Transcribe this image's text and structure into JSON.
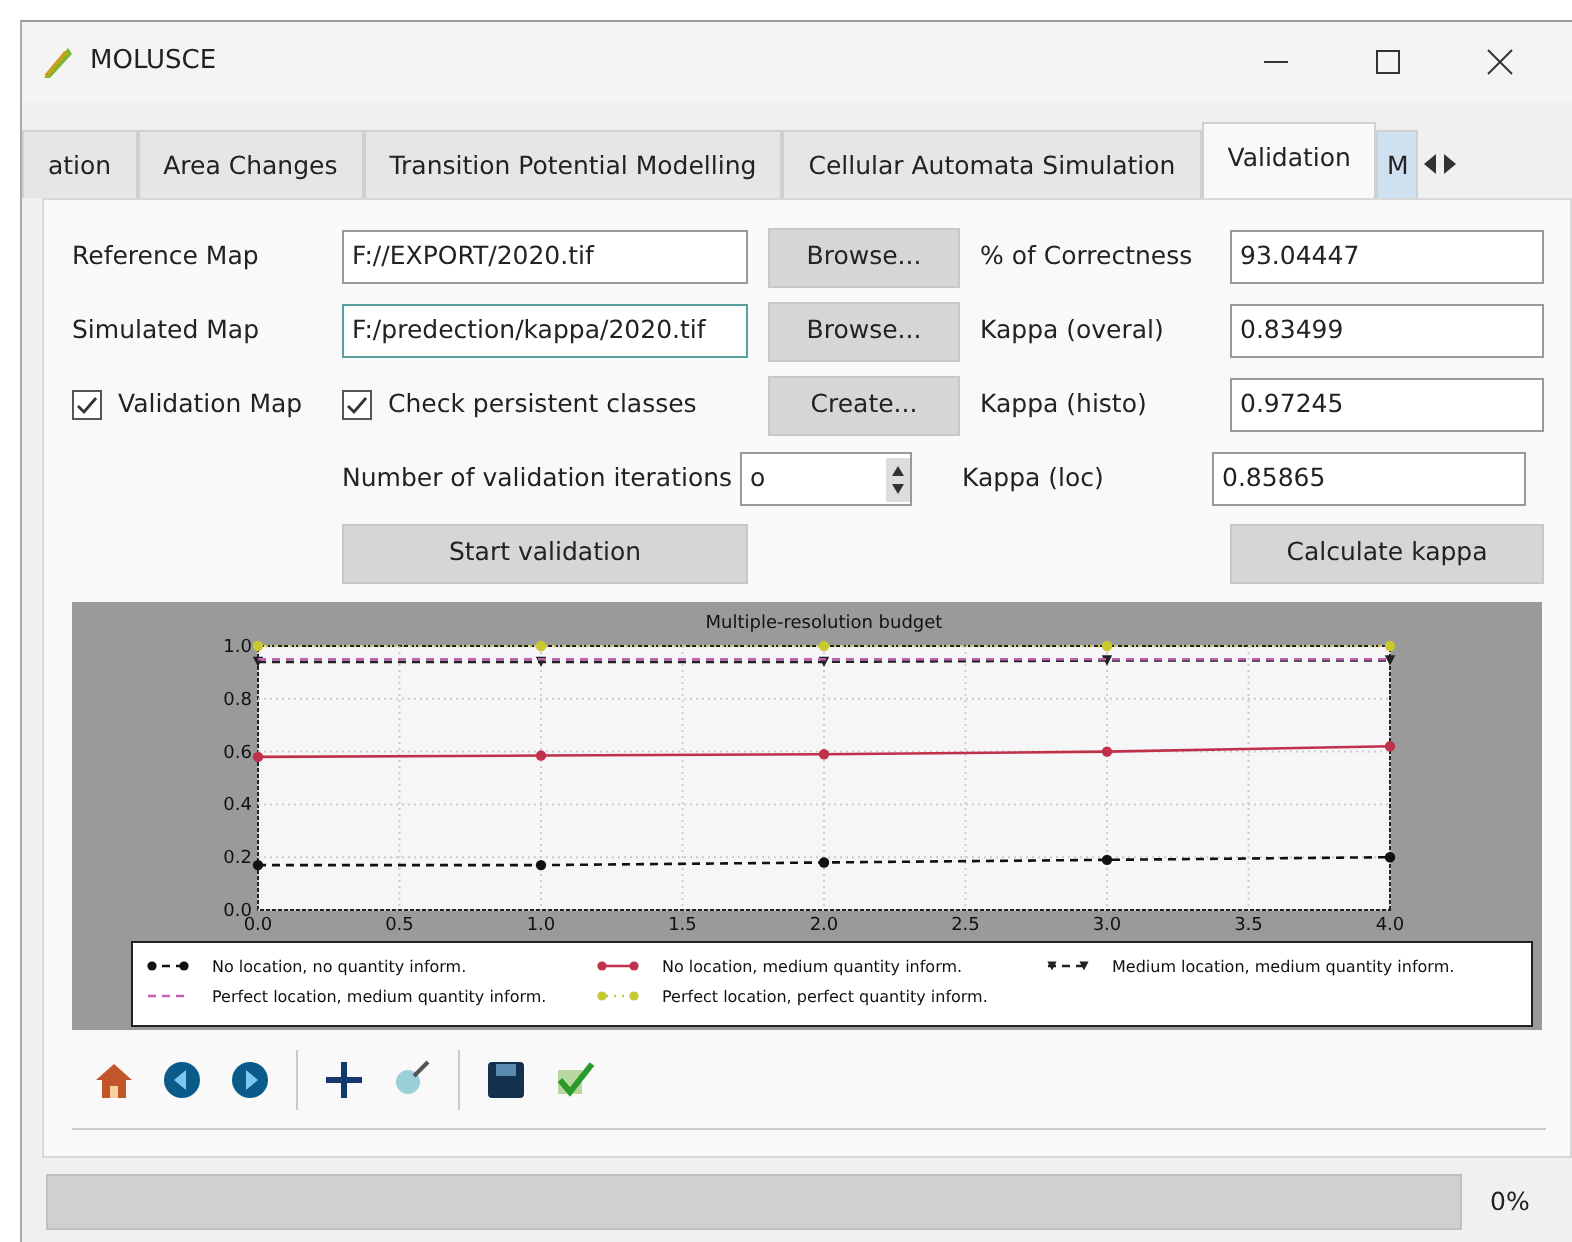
{
  "window": {
    "title": "MOLUSCE"
  },
  "tabs": [
    {
      "label": "ation",
      "selected": false
    },
    {
      "label": "Area Changes",
      "selected": false
    },
    {
      "label": "Transition Potential Modelling",
      "selected": false
    },
    {
      "label": "Cellular Automata Simulation",
      "selected": false
    },
    {
      "label": "Validation",
      "selected": true
    },
    {
      "label": "M",
      "selected": false
    }
  ],
  "form": {
    "reference_map": {
      "label": "Reference Map",
      "value": "F://EXPORT/2020.tif",
      "button": "Browse..."
    },
    "simulated_map": {
      "label": "Simulated Map",
      "value": "F:/predection/kappa/2020.tif",
      "button": "Browse..."
    },
    "validation_map": {
      "label": "Validation Map",
      "checked": true
    },
    "check_persistent": {
      "label": "Check persistent classes",
      "checked": true
    },
    "create_button": "Create...",
    "iterations": {
      "label": "Number of validation iterations",
      "value": "o"
    },
    "start_button": "Start validation",
    "results": [
      {
        "label": "% of Correctness",
        "value": "93.04447"
      },
      {
        "label": "Kappa (overal)",
        "value": "0.83499"
      },
      {
        "label": "Kappa (histo)",
        "value": "0.97245"
      },
      {
        "label": "Kappa (loc)",
        "value": "0.85865"
      }
    ],
    "calculate_button": "Calculate kappa"
  },
  "chart_data": {
    "type": "line",
    "title": "Multiple-resolution budget",
    "x": [
      0,
      1,
      2,
      3,
      4
    ],
    "xlim": [
      0,
      4
    ],
    "ylim": [
      0,
      1
    ],
    "xticks": [
      {
        "value": 0,
        "label": "0.0"
      },
      {
        "value": 0.5,
        "label": "0.5"
      },
      {
        "value": 1,
        "label": "1.0"
      },
      {
        "value": 1.5,
        "label": "1.5"
      },
      {
        "value": 2,
        "label": "2.0"
      },
      {
        "value": 2.5,
        "label": "2.5"
      },
      {
        "value": 3,
        "label": "3.0"
      },
      {
        "value": 3.5,
        "label": "3.5"
      },
      {
        "value": 4,
        "label": "4.0"
      }
    ],
    "yticks": [
      {
        "value": 0,
        "label": "0.0"
      },
      {
        "value": 0.2,
        "label": "0.2"
      },
      {
        "value": 0.4,
        "label": "0.4"
      },
      {
        "value": 0.6,
        "label": "0.6"
      },
      {
        "value": 0.8,
        "label": "0.8"
      },
      {
        "value": 1,
        "label": "1.0"
      }
    ],
    "grid": true,
    "legend": true,
    "series": [
      {
        "name": "No location, no quantity inform.",
        "color": "#111111",
        "line_style": "dashed",
        "marker": "o",
        "values": [
          0.17,
          0.17,
          0.18,
          0.19,
          0.2
        ]
      },
      {
        "name": "No location, medium quantity inform.",
        "color": "#c0304a",
        "line_style": "solid",
        "marker": "o",
        "values": [
          0.58,
          0.585,
          0.59,
          0.6,
          0.62
        ]
      },
      {
        "name": "Medium location, medium quantity inform.",
        "color": "#222222",
        "line_style": "dashed",
        "marker": "v",
        "values": [
          0.94,
          0.94,
          0.94,
          0.945,
          0.945
        ]
      },
      {
        "name": "Perfect location, medium quantity inform.",
        "color": "#c060b0",
        "line_style": "dashed",
        "marker": "none",
        "values": [
          0.95,
          0.95,
          0.95,
          0.95,
          0.95
        ]
      },
      {
        "name": "Perfect location, perfect quantity inform.",
        "color": "#c8c830",
        "line_style": "dotted",
        "marker": "o",
        "values": [
          1,
          1,
          1,
          1,
          1
        ]
      }
    ]
  },
  "progress": {
    "level": 0,
    "reading": "0%"
  }
}
